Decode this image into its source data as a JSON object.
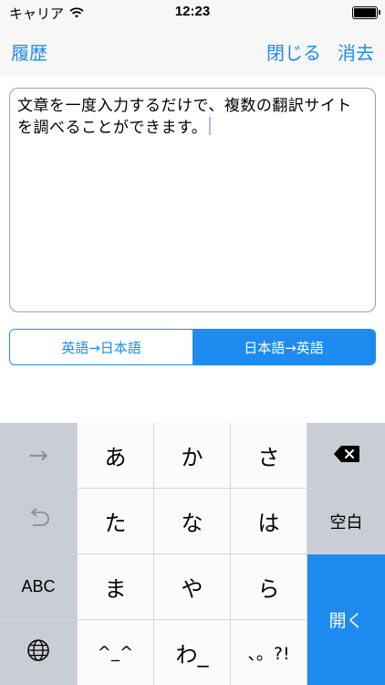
{
  "status": {
    "carrier": "キャリア",
    "time": "12:23"
  },
  "nav": {
    "history": "履歴",
    "close": "閉じる",
    "clear": "消去"
  },
  "editor": {
    "text": "文章を一度入力するだけで、複数の翻訳サイトを調べることができます。"
  },
  "segments": [
    {
      "label": "英語→日本語",
      "selected": false
    },
    {
      "label": "日本語→英語",
      "selected": true
    }
  ],
  "keyboard": {
    "row1": {
      "arrow": "→",
      "k1": "あ",
      "k2": "か",
      "k3": "さ"
    },
    "row2": {
      "k1": "た",
      "k2": "な",
      "k3": "は",
      "space": "空白"
    },
    "row3": {
      "abc": "ABC",
      "k1": "ま",
      "k2": "や",
      "k3": "ら"
    },
    "row4": {
      "k1": "^_^",
      "k2": "わ_",
      "k3": "、。?!"
    },
    "open": "開く"
  },
  "colors": {
    "accent": "#1e8bf0",
    "keyboard_bg": "#d1d5db",
    "key_gray": "#c9cdd4"
  },
  "icons": [
    "wifi-icon",
    "battery-icon",
    "forward-arrow-icon",
    "undo-icon",
    "globe-icon",
    "backspace-icon"
  ]
}
